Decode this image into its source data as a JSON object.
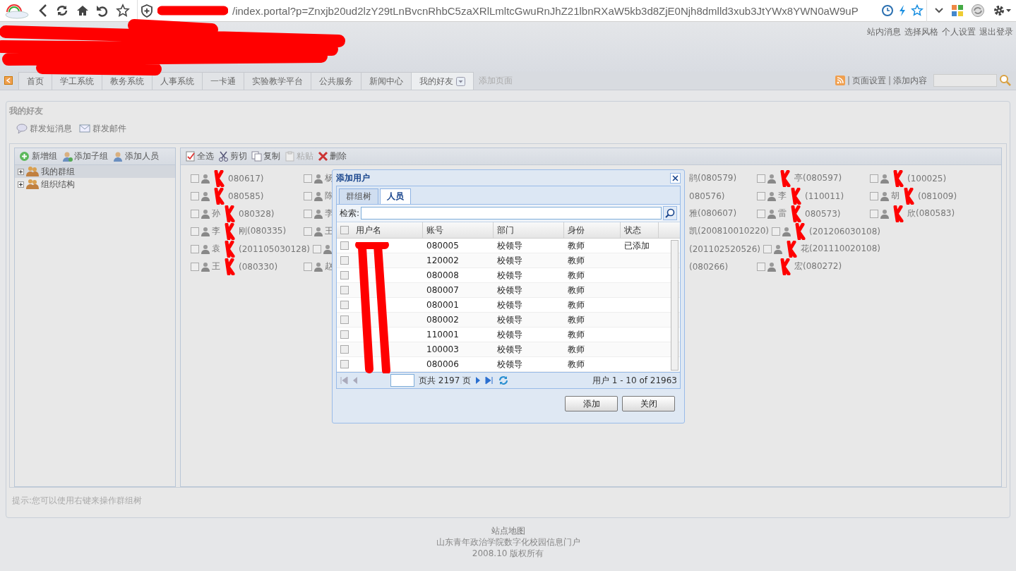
{
  "browser": {
    "url": "/index.portal?p=Znxjb20ud2lzY29tLnBvcnRhbC5zaXRlLmltcGwuRnJhZ21lbnRXaW5kb3d8ZjE0Njh8dmlld3xub3JtYWx8YWN0aW9uP"
  },
  "header_links": [
    "站内消息",
    "选择风格",
    "个人设置",
    "退出登录"
  ],
  "nav": {
    "tabs": [
      {
        "label": "首页",
        "selected": false
      },
      {
        "label": "学工系统",
        "selected": false
      },
      {
        "label": "教务系统",
        "selected": false
      },
      {
        "label": "人事系统",
        "selected": false
      },
      {
        "label": "一卡通",
        "selected": false
      },
      {
        "label": "实验教学平台",
        "selected": false
      },
      {
        "label": "公共服务",
        "selected": false
      },
      {
        "label": "新闻中心",
        "selected": false
      },
      {
        "label": "我的好友",
        "selected": true
      }
    ],
    "add_page": "添加页面",
    "links": [
      {
        "sep": "|",
        "label": "页面设置"
      },
      {
        "sep": "|",
        "label": "添加内容"
      }
    ]
  },
  "panel": {
    "title": "我的好友",
    "actions": [
      "群发短消息",
      "群发邮件"
    ],
    "tree_toolbar": [
      "新增组",
      "添加子组",
      "添加人员"
    ],
    "tree": [
      {
        "label": "我的群组",
        "selected": true
      },
      {
        "label": "组织结构",
        "selected": false
      }
    ],
    "list_toolbar": [
      {
        "label": "全选",
        "disabled": false
      },
      {
        "label": "剪切",
        "disabled": false
      },
      {
        "label": "复制",
        "disabled": false
      },
      {
        "label": "粘贴",
        "disabled": true
      },
      {
        "label": "删除",
        "disabled": false
      }
    ],
    "friends": [
      {
        "left": [
          {
            "kind": "full",
            "checked": false,
            "after": "080617)"
          },
          {
            "kind": "full",
            "checked": false,
            "text": "杨"
          }
        ],
        "right": [
          {
            "kind": "clipped",
            "text": "鹃(080579)"
          },
          {
            "kind": "full",
            "checked": false,
            "after": "亭(080597)"
          },
          {
            "kind": "full",
            "checked": false,
            "after": "(100025)"
          }
        ]
      },
      {
        "left": [
          {
            "kind": "full",
            "checked": false,
            "after": "080585)"
          },
          {
            "kind": "full",
            "checked": false,
            "text": "陈"
          }
        ],
        "right": [
          {
            "kind": "clipped",
            "text": "080576)"
          },
          {
            "kind": "full",
            "checked": false,
            "before": "李",
            "after": "(110011)"
          },
          {
            "kind": "full",
            "checked": false,
            "before": "胡",
            "after": "(081009)"
          }
        ]
      },
      {
        "left": [
          {
            "kind": "full",
            "checked": false,
            "before": "孙",
            "after": "080328)"
          },
          {
            "kind": "full",
            "checked": false,
            "text": "李"
          }
        ],
        "right": [
          {
            "kind": "clipped",
            "text": "雅(080607)"
          },
          {
            "kind": "full",
            "checked": false,
            "before": "雷",
            "after": "080573)"
          },
          {
            "kind": "full",
            "checked": false,
            "after": "欣(080583)"
          }
        ]
      },
      {
        "left": [
          {
            "kind": "full",
            "checked": false,
            "before": "李",
            "after": "刚(080335)"
          },
          {
            "kind": "full",
            "checked": false,
            "text": "王"
          }
        ],
        "right": [
          {
            "kind": "clipped",
            "text": "凯(200810010220)"
          },
          {
            "kind": "full",
            "checked": false,
            "after": "(201206030108)"
          }
        ]
      },
      {
        "left": [
          {
            "kind": "full",
            "checked": false,
            "before": "袁",
            "after": "(201105030128)"
          },
          {
            "kind": "full",
            "checked": false
          }
        ],
        "right": [
          {
            "kind": "clipped",
            "text": "(201102520526)"
          },
          {
            "kind": "full",
            "checked": false,
            "after": "花(201110020108)"
          }
        ]
      },
      {
        "left": [
          {
            "kind": "full",
            "checked": false,
            "before": "王",
            "after": "(080330)"
          },
          {
            "kind": "full",
            "checked": false,
            "text": "赵"
          }
        ],
        "right": [
          {
            "kind": "clipped",
            "text": "(080266)"
          },
          {
            "kind": "full",
            "checked": false,
            "after": "宏(080272)"
          }
        ]
      }
    ],
    "hint": "提示:您可以使用右键来操作群组树"
  },
  "dialog": {
    "title": "添加用户",
    "tabs": [
      {
        "label": "群组树",
        "selected": false
      },
      {
        "label": "人员",
        "selected": true
      }
    ],
    "search_label": "检索:",
    "select_all_checked": false,
    "columns": [
      "用户名",
      "账号",
      "部门",
      "身份",
      "状态"
    ],
    "rows": [
      {
        "checked": false,
        "account": "080005",
        "dept": "校领导",
        "role": "教师",
        "status": "已添加"
      },
      {
        "checked": false,
        "account": "120002",
        "dept": "校领导",
        "role": "教师"
      },
      {
        "checked": false,
        "account": "080008",
        "dept": "校领导",
        "role": "教师"
      },
      {
        "checked": false,
        "account": "080007",
        "dept": "校领导",
        "role": "教师"
      },
      {
        "checked": false,
        "account": "080001",
        "dept": "校领导",
        "role": "教师"
      },
      {
        "checked": false,
        "account": "080002",
        "dept": "校领导",
        "role": "教师"
      },
      {
        "checked": false,
        "account": "110001",
        "dept": "校领导",
        "role": "教师"
      },
      {
        "checked": false,
        "account": "100003",
        "dept": "校领导",
        "role": "教师"
      },
      {
        "checked": false,
        "account": "080006",
        "dept": "校领导",
        "role": "教师"
      }
    ],
    "pager": {
      "pages": "页共 2197 页",
      "summary": "用户 1 - 10 of 21963"
    },
    "buttons": [
      "添加",
      "关闭"
    ]
  },
  "footer": [
    "站点地图",
    "山东青年政治学院数字化校园信息门户",
    "2008.10 版权所有"
  ]
}
